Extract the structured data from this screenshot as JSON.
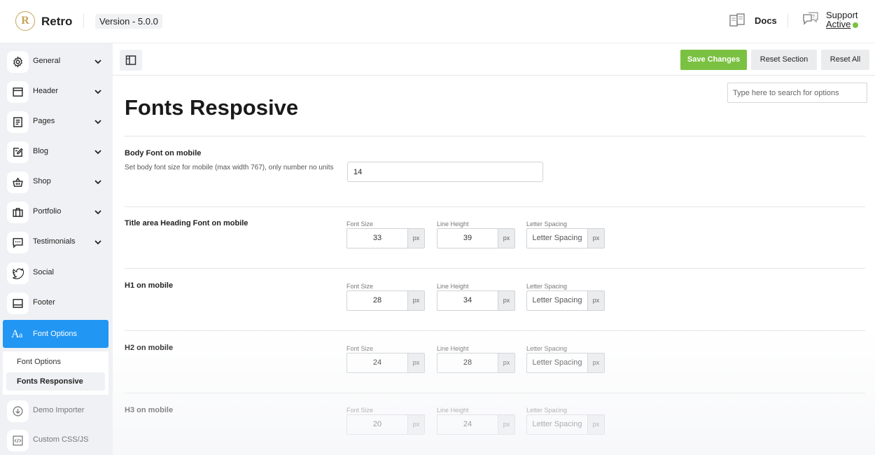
{
  "header": {
    "brand": "Retro",
    "logo_letter": "R",
    "version": "Version - 5.0.0",
    "docs": "Docs",
    "support": "Support",
    "support_status": "Active",
    "status_color": "#7ac142"
  },
  "sidebar": {
    "items": [
      {
        "label": "General",
        "icon": "gear-icon"
      },
      {
        "label": "Header",
        "icon": "header-layout-icon"
      },
      {
        "label": "Pages",
        "icon": "pages-icon"
      },
      {
        "label": "Blog",
        "icon": "blog-edit-icon"
      },
      {
        "label": "Shop",
        "icon": "basket-icon"
      },
      {
        "label": "Portfolio",
        "icon": "briefcase-icon"
      },
      {
        "label": "Testimonials",
        "icon": "chat-icon"
      },
      {
        "label": "Social",
        "icon": "twitter-icon"
      },
      {
        "label": "Footer",
        "icon": "footer-layout-icon"
      },
      {
        "label": "Font Options",
        "icon": "font-icon"
      },
      {
        "label": "Demo Importer",
        "icon": "download-icon"
      },
      {
        "label": "Custom CSS/JS",
        "icon": "code-icon"
      }
    ],
    "submenu": [
      {
        "label": "Font Options"
      },
      {
        "label": "Fonts Responsive"
      }
    ],
    "accent_color": "#2196f3"
  },
  "toolbar": {
    "save": "Save Changes",
    "reset_section": "Reset Section",
    "reset_all": "Reset All",
    "save_color": "#7ac142"
  },
  "search": {
    "placeholder": "Type here to search for options"
  },
  "page_title": "Fonts Resposive",
  "body_font": {
    "title": "Body Font on mobile",
    "desc": "Set body font size for mobile (max width 767), only number no units",
    "value": "14"
  },
  "captions": {
    "font_size": "Font Size",
    "line_height": "Line Height",
    "letter_spacing": "Letter Spacing",
    "unit": "px"
  },
  "rows": [
    {
      "title": "Title area Heading Font on mobile",
      "font_size": "33",
      "line_height": "39",
      "letter_spacing": "Letter Spacing"
    },
    {
      "title": "H1 on mobile",
      "font_size": "28",
      "line_height": "34",
      "letter_spacing": "Letter Spacing"
    },
    {
      "title": "H2 on mobile",
      "font_size": "24",
      "line_height": "28",
      "letter_spacing": "Letter Spacing"
    },
    {
      "title": "H3 on mobile",
      "font_size": "20",
      "line_height": "24",
      "letter_spacing": "Letter Spacing"
    }
  ]
}
